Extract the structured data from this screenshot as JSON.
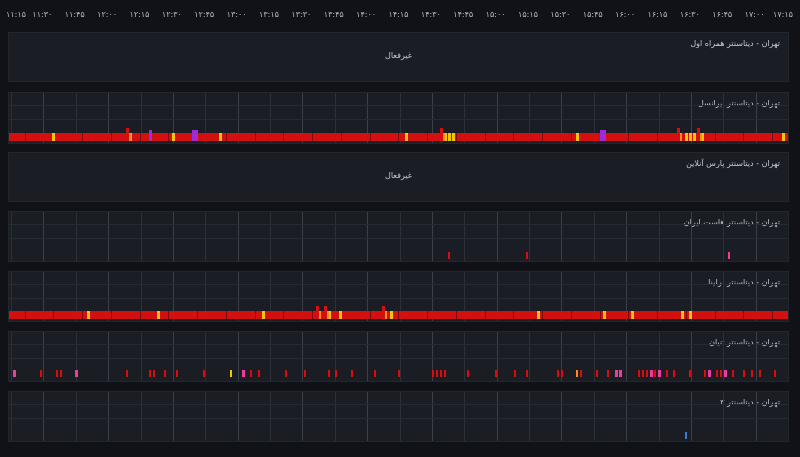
{
  "timeline": {
    "ticks": [
      "۱۱:۱۵",
      "۱۱:۳۰",
      "۱۱:۴۵",
      "۱۲:۰۰",
      "۱۲:۱۵",
      "۱۲:۳۰",
      "۱۲:۴۵",
      "۱۳:۰۰",
      "۱۳:۱۵",
      "۱۳:۳۰",
      "۱۳:۴۵",
      "۱۴:۰۰",
      "۱۴:۱۵",
      "۱۴:۳۰",
      "۱۴:۴۵",
      "۱۵:۰۰",
      "۱۵:۱۵",
      "۱۵:۳۰",
      "۱۵:۴۵",
      "۱۶:۰۰",
      "۱۶:۱۵",
      "۱۶:۳۰",
      "۱۶:۴۵",
      "۱۷:۰۰",
      "۱۷:۱۵"
    ]
  },
  "colors": {
    "background": "#111217",
    "panel": "#1a1d24",
    "red": "#d40f0f",
    "yellow": "#f2c40d",
    "orange": "#ff8c1a",
    "purple": "#9b2cd6",
    "pink": "#e8409a",
    "blue": "#3a7bd5"
  },
  "panels": [
    {
      "id": "p1",
      "title": "تهران - دیتاسنتر همراه اول",
      "status": "غیرفعال",
      "mode": "inactive"
    },
    {
      "id": "p2",
      "title": "تهران - دیتاسنتر ایرانسل",
      "status": "",
      "mode": "continuous",
      "yellow": [
        0.055,
        0.155,
        0.21,
        0.27,
        0.51,
        0.56,
        0.565,
        0.57,
        0.73,
        0.87,
        0.875,
        0.88,
        0.89,
        0.995
      ],
      "purple": [
        0.18,
        0.235,
        0.24,
        0.76,
        0.765
      ],
      "orange": [
        0.15,
        0.555,
        0.86,
        0.885
      ]
    },
    {
      "id": "p3",
      "title": "تهران - دیتاسنتر پارس آنلاین",
      "status": "غیرفعال",
      "mode": "inactive"
    },
    {
      "id": "p4",
      "title": "تهران - دیتاسنتر هاست ایران",
      "status": "",
      "mode": "sparse",
      "red": [
        0.565,
        0.665
      ],
      "pink": [
        0.925
      ],
      "blue": []
    },
    {
      "id": "p5",
      "title": "تهران - دیتاسنتر برلینا",
      "status": "",
      "mode": "continuous",
      "yellow": [
        0.1,
        0.19,
        0.325,
        0.41,
        0.425,
        0.49,
        0.68,
        0.765,
        0.8,
        0.865,
        0.875
      ],
      "purple": [],
      "orange": [
        0.395,
        0.405,
        0.48
      ]
    },
    {
      "id": "p6",
      "title": "تهران - دیتاسنتر ثنیان",
      "status": "",
      "mode": "scattered",
      "red": [
        0.04,
        0.06,
        0.065,
        0.15,
        0.18,
        0.185,
        0.2,
        0.215,
        0.25,
        0.31,
        0.32,
        0.355,
        0.38,
        0.41,
        0.42,
        0.44,
        0.47,
        0.5,
        0.545,
        0.55,
        0.555,
        0.56,
        0.59,
        0.625,
        0.65,
        0.665,
        0.705,
        0.71,
        0.735,
        0.755,
        0.77,
        0.81,
        0.815,
        0.82,
        0.83,
        0.845,
        0.855,
        0.875,
        0.895,
        0.91,
        0.915,
        0.93,
        0.945,
        0.955,
        0.965,
        0.985
      ],
      "pink": [
        0.005,
        0.085,
        0.3,
        0.78,
        0.785,
        0.825,
        0.835,
        0.9,
        0.92
      ],
      "yellow": [
        0.285
      ],
      "orange": [
        0.73
      ]
    },
    {
      "id": "p7",
      "title": "تهران - دیتاسنتر ۳",
      "status": "",
      "mode": "sparse",
      "red": [],
      "pink": [],
      "blue": [
        0.87
      ]
    }
  ]
}
